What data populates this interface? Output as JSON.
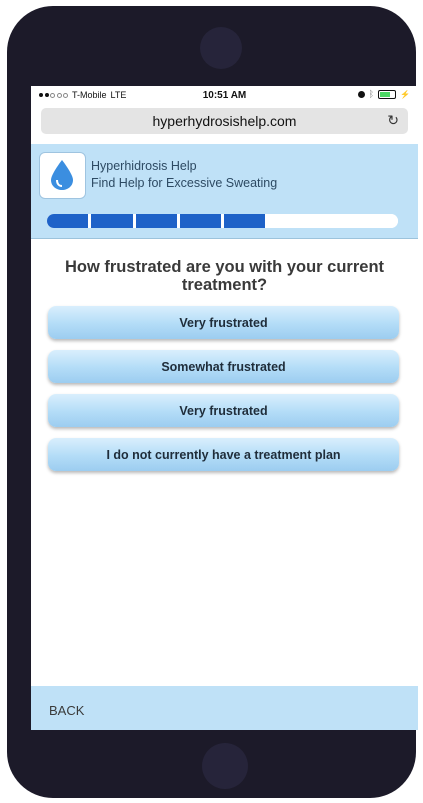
{
  "status_bar": {
    "carrier": "T-Mobile",
    "network": "LTE",
    "time": "10:51 AM",
    "icons": [
      "alarm-icon",
      "bluetooth-icon",
      "battery-icon",
      "charging-icon"
    ]
  },
  "browser": {
    "url": "hyperhydrosishelp.com",
    "reload_icon": "reload-icon"
  },
  "header": {
    "title": "Hyperhidrosis Help",
    "tagline": "Find Help for Excessive Sweating",
    "logo_icon": "water-drop-icon"
  },
  "progress": {
    "completed_steps": 5,
    "total_steps": 8,
    "fill_color": "#1e62c8"
  },
  "question": {
    "text": "How frustrated are you with your current treatment?"
  },
  "answers": [
    "Very frustrated",
    "Somewhat frustrated",
    "Very frustrated",
    "I do not currently have a treatment plan"
  ],
  "footer": {
    "back_label": "BACK"
  },
  "colors": {
    "header_bg": "#bfe1f7",
    "phone_body": "#1c1a29",
    "button_bg": "#b3dcf7"
  }
}
